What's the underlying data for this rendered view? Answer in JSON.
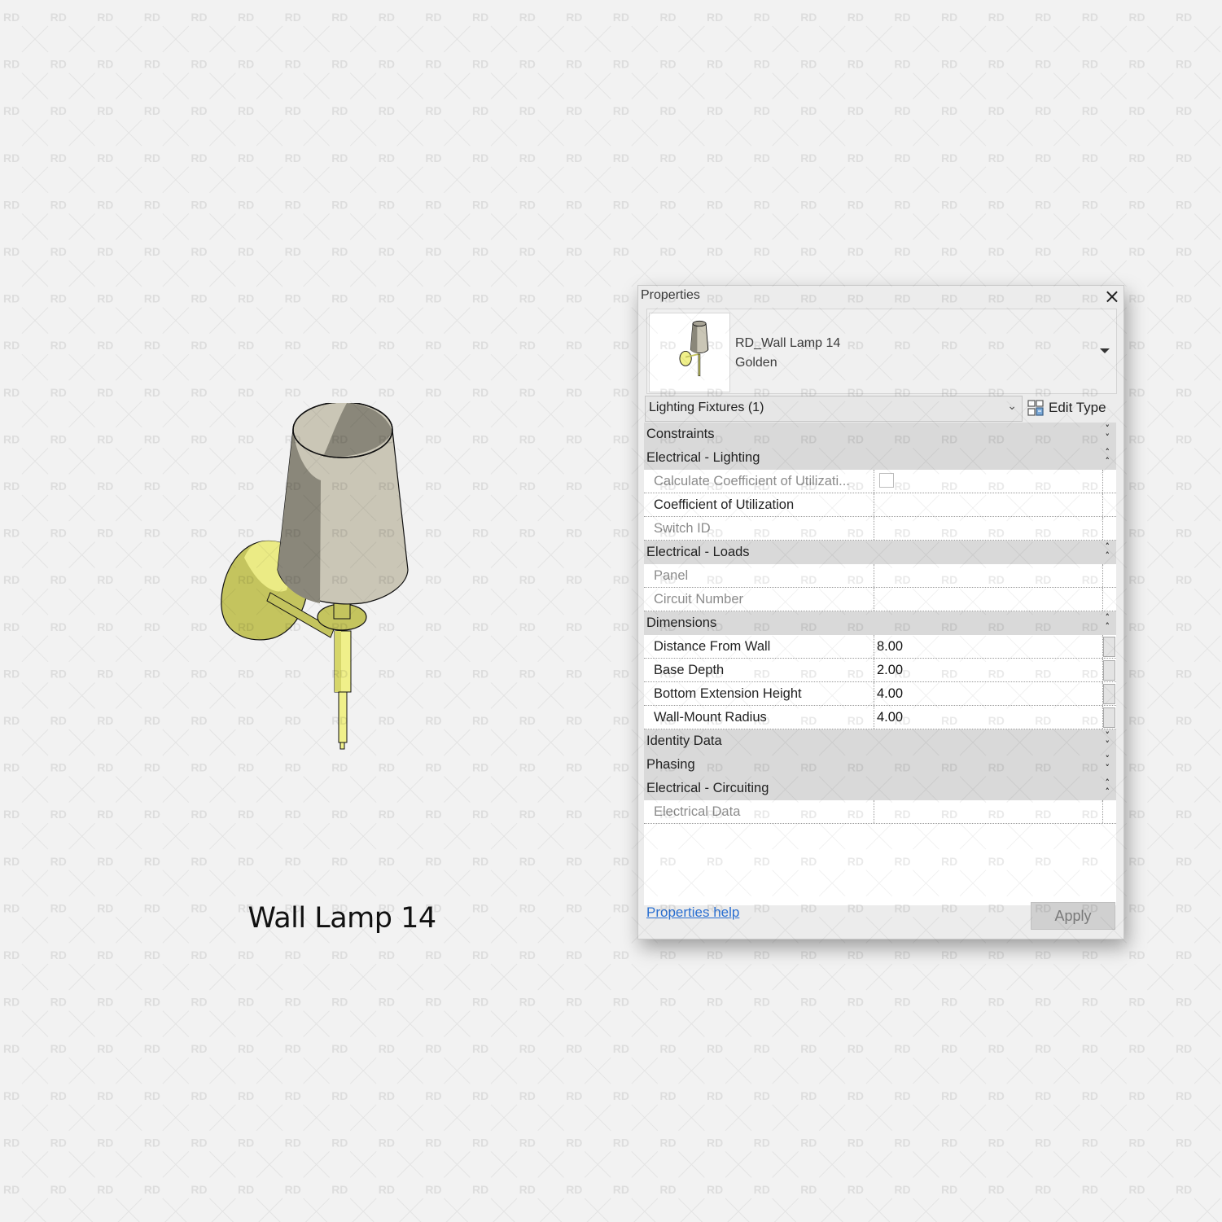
{
  "caption": "Wall Lamp 14",
  "watermark": "RD",
  "colors": {
    "background": "#f2f2f2",
    "shade_light": "#cac6b6",
    "shade_dark": "#8a877a",
    "brass": "#f0f08a",
    "brass_dark": "#c4c45e",
    "link": "#2a6fd1",
    "group_header": "#d9d9d9"
  },
  "palette": {
    "title": "Properties",
    "close_icon": "×",
    "type_selector": {
      "family": "RD_Wall Lamp 14",
      "type": "Golden",
      "dropdown_icon": "caret-down"
    },
    "filter": {
      "selected": "Lighting Fixtures (1)",
      "chevron": "⌄"
    },
    "edit_type_label": "Edit Type",
    "groups": [
      {
        "label": "Constraints",
        "toggle": "⌄⌄",
        "expanded": false,
        "rows": []
      },
      {
        "label": "Electrical - Lighting",
        "toggle": "⌃⌃",
        "expanded": true,
        "rows": [
          {
            "name": "Calculate Coefficient of Utilizati...",
            "value": "",
            "kind": "checkbox",
            "checked": false,
            "readonly": true
          },
          {
            "name": "Coefficient of Utilization",
            "value": "",
            "kind": "text",
            "readonly": false
          },
          {
            "name": "Switch ID",
            "value": "",
            "kind": "text",
            "readonly": true
          }
        ]
      },
      {
        "label": "Electrical - Loads",
        "toggle": "⌃⌃",
        "expanded": true,
        "rows": [
          {
            "name": "Panel",
            "value": "",
            "kind": "text",
            "readonly": true
          },
          {
            "name": "Circuit Number",
            "value": "",
            "kind": "text",
            "readonly": true
          }
        ]
      },
      {
        "label": "Dimensions",
        "toggle": "⌃⌃",
        "expanded": true,
        "rows": [
          {
            "name": "Distance From Wall",
            "value": "8.00",
            "kind": "text",
            "readonly": false,
            "assoc": true
          },
          {
            "name": "Base Depth",
            "value": "2.00",
            "kind": "text",
            "readonly": false,
            "assoc": true
          },
          {
            "name": "Bottom Extension Height",
            "value": "4.00",
            "kind": "text",
            "readonly": false,
            "assoc": true
          },
          {
            "name": "Wall-Mount Radius",
            "value": "4.00",
            "kind": "text",
            "readonly": false,
            "assoc": true
          }
        ]
      },
      {
        "label": "Identity Data",
        "toggle": "⌄⌄",
        "expanded": false,
        "rows": []
      },
      {
        "label": "Phasing",
        "toggle": "⌄⌄",
        "expanded": false,
        "rows": []
      },
      {
        "label": "Electrical - Circuiting",
        "toggle": "⌃⌃",
        "expanded": true,
        "rows": [
          {
            "name": "Electrical Data",
            "value": "",
            "kind": "text",
            "readonly": true
          }
        ]
      }
    ],
    "help_link": "Properties help",
    "apply_label": "Apply"
  }
}
